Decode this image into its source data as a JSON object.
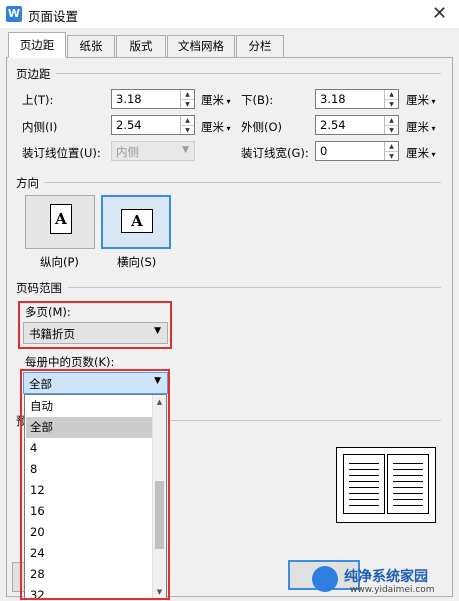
{
  "window": {
    "title": "页面设置",
    "icon_letter": "W"
  },
  "tabs": [
    {
      "label": "页边距",
      "active": true
    },
    {
      "label": "纸张"
    },
    {
      "label": "版式"
    },
    {
      "label": "文档网格"
    },
    {
      "label": "分栏"
    }
  ],
  "margins": {
    "section_title": "页边距",
    "top": {
      "label": "上(T):",
      "value": "3.18",
      "unit": "厘米"
    },
    "bottom": {
      "label": "下(B):",
      "value": "3.18",
      "unit": "厘米"
    },
    "inside": {
      "label": "内侧(I)",
      "value": "2.54",
      "unit": "厘米"
    },
    "outside": {
      "label": "外侧(O)",
      "value": "2.54",
      "unit": "厘米"
    },
    "gutter_position": {
      "label": "装订线位置(U):",
      "value": "内侧"
    },
    "gutter_width": {
      "label": "装订线宽(G):",
      "value": "0",
      "unit": "厘米"
    }
  },
  "orientation": {
    "section_title": "方向",
    "portrait_label": "纵向(P)",
    "landscape_label": "横向(S)",
    "glyph": "A",
    "selected": "landscape"
  },
  "pages": {
    "section_title": "页码范围",
    "multiple_label": "多页(M):",
    "multiple_value": "书籍折页",
    "per_booklet_label": "每册中的页数(K):",
    "per_booklet_value": "全部",
    "options": [
      "自动",
      "全部",
      "4",
      "8",
      "12",
      "16",
      "20",
      "24",
      "28",
      "32"
    ],
    "highlighted_option": "全部"
  },
  "preview": {
    "section_title_partial": "预"
  },
  "colors": {
    "accent": "#3c8de0",
    "highlight_box": "#e03030"
  },
  "watermark": {
    "text": "纯净系统家园",
    "url": "www.yidaimei.com"
  }
}
